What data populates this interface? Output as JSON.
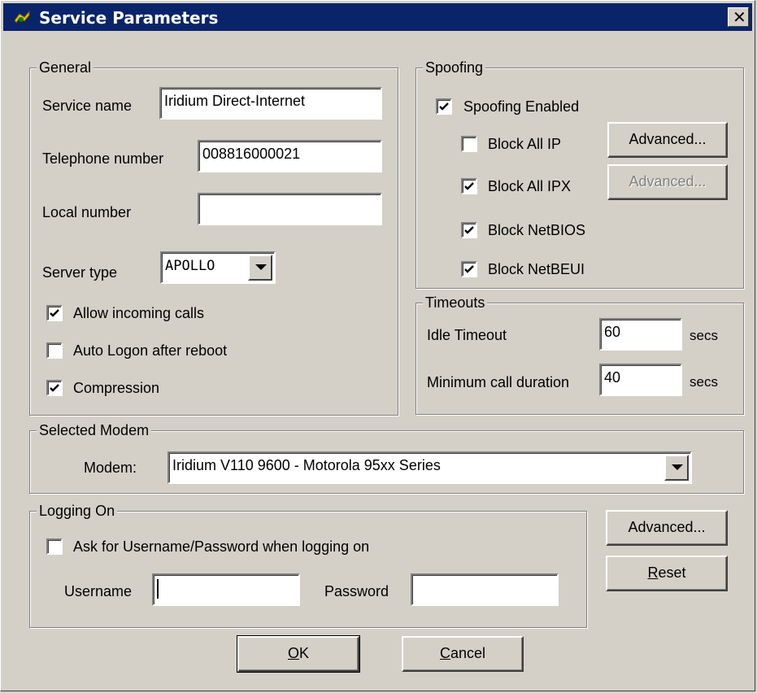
{
  "window": {
    "title": "Service Parameters",
    "close_glyph": "✕"
  },
  "general": {
    "legend": "General",
    "service_name_label": "Service name",
    "service_name_value": "Iridium Direct-Internet",
    "telephone_label": "Telephone number",
    "telephone_value": "008816000021",
    "local_number_label": "Local number",
    "local_number_value": "",
    "server_type_label": "Server type",
    "server_type_value": "APOLLO",
    "allow_incoming_label": "Allow incoming calls",
    "allow_incoming_checked": true,
    "auto_logon_label": "Auto Logon after reboot",
    "auto_logon_checked": false,
    "compression_label": "Compression",
    "compression_checked": true
  },
  "spoofing": {
    "legend": "Spoofing",
    "enabled_label": "Spoofing Enabled",
    "enabled_checked": true,
    "block_ip_label": "Block All IP",
    "block_ip_checked": false,
    "block_ip_advanced": "Advanced...",
    "block_ipx_label": "Block All IPX",
    "block_ipx_checked": true,
    "block_ipx_advanced": "Advanced...",
    "block_netbios_label": "Block NetBIOS",
    "block_netbios_checked": true,
    "block_netbeui_label": "Block NetBEUI",
    "block_netbeui_checked": true
  },
  "timeouts": {
    "legend": "Timeouts",
    "idle_label": "Idle Timeout",
    "idle_value": "60",
    "idle_unit": "secs",
    "min_call_label": "Minimum call duration",
    "min_call_value": "40",
    "min_call_unit": "secs"
  },
  "modem": {
    "legend": "Selected Modem",
    "label": "Modem:",
    "value": "Iridium V110 9600 - Motorola 95xx Series"
  },
  "logging": {
    "legend": "Logging On",
    "ask_label": "Ask for Username/Password when logging on",
    "ask_checked": false,
    "username_label": "Username",
    "username_value": "",
    "password_label": "Password",
    "password_value": ""
  },
  "buttons": {
    "advanced": "Advanced...",
    "reset_accel": "R",
    "reset_rest": "eset",
    "ok_accel": "O",
    "ok_rest": "K",
    "cancel_accel": "C",
    "cancel_rest": "ancel"
  },
  "icons": {
    "app": "service-app-icon",
    "close": "close-icon",
    "check": "check-icon",
    "dropdown": "chevron-down-icon"
  }
}
